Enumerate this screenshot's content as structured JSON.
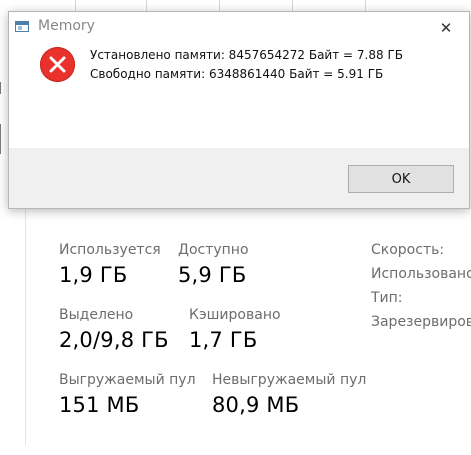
{
  "dialog": {
    "title": "Memory",
    "close_glyph": "✕",
    "icon": "error-icon",
    "message_lines": [
      "Установлено памяти:  8457654272 Байт = 7.88 ГБ",
      "Свободно памяти:  6348861440 Байт = 5.91 ГБ"
    ],
    "ok_label": "OK"
  },
  "memory": {
    "in_use": {
      "label": "Используется",
      "value": "1,9 ГБ"
    },
    "available": {
      "label": "Доступно",
      "value": "5,9 ГБ"
    },
    "committed": {
      "label": "Выделено",
      "value": "2,0/9,8 ГБ"
    },
    "cached": {
      "label": "Кэшировано",
      "value": "1,7 ГБ"
    },
    "paged_pool": {
      "label": "Выгружаемый пул",
      "value": "151 МБ"
    },
    "nonpaged_pool": {
      "label": "Невыгружаемый пул",
      "value": "80,9 МБ"
    }
  },
  "side_labels": [
    "Скорость:",
    "Использовано",
    "Тип:",
    "Зарезервиров"
  ],
  "colors": {
    "error_red": "#e8322b",
    "button_gray": "#e1e1e1"
  }
}
